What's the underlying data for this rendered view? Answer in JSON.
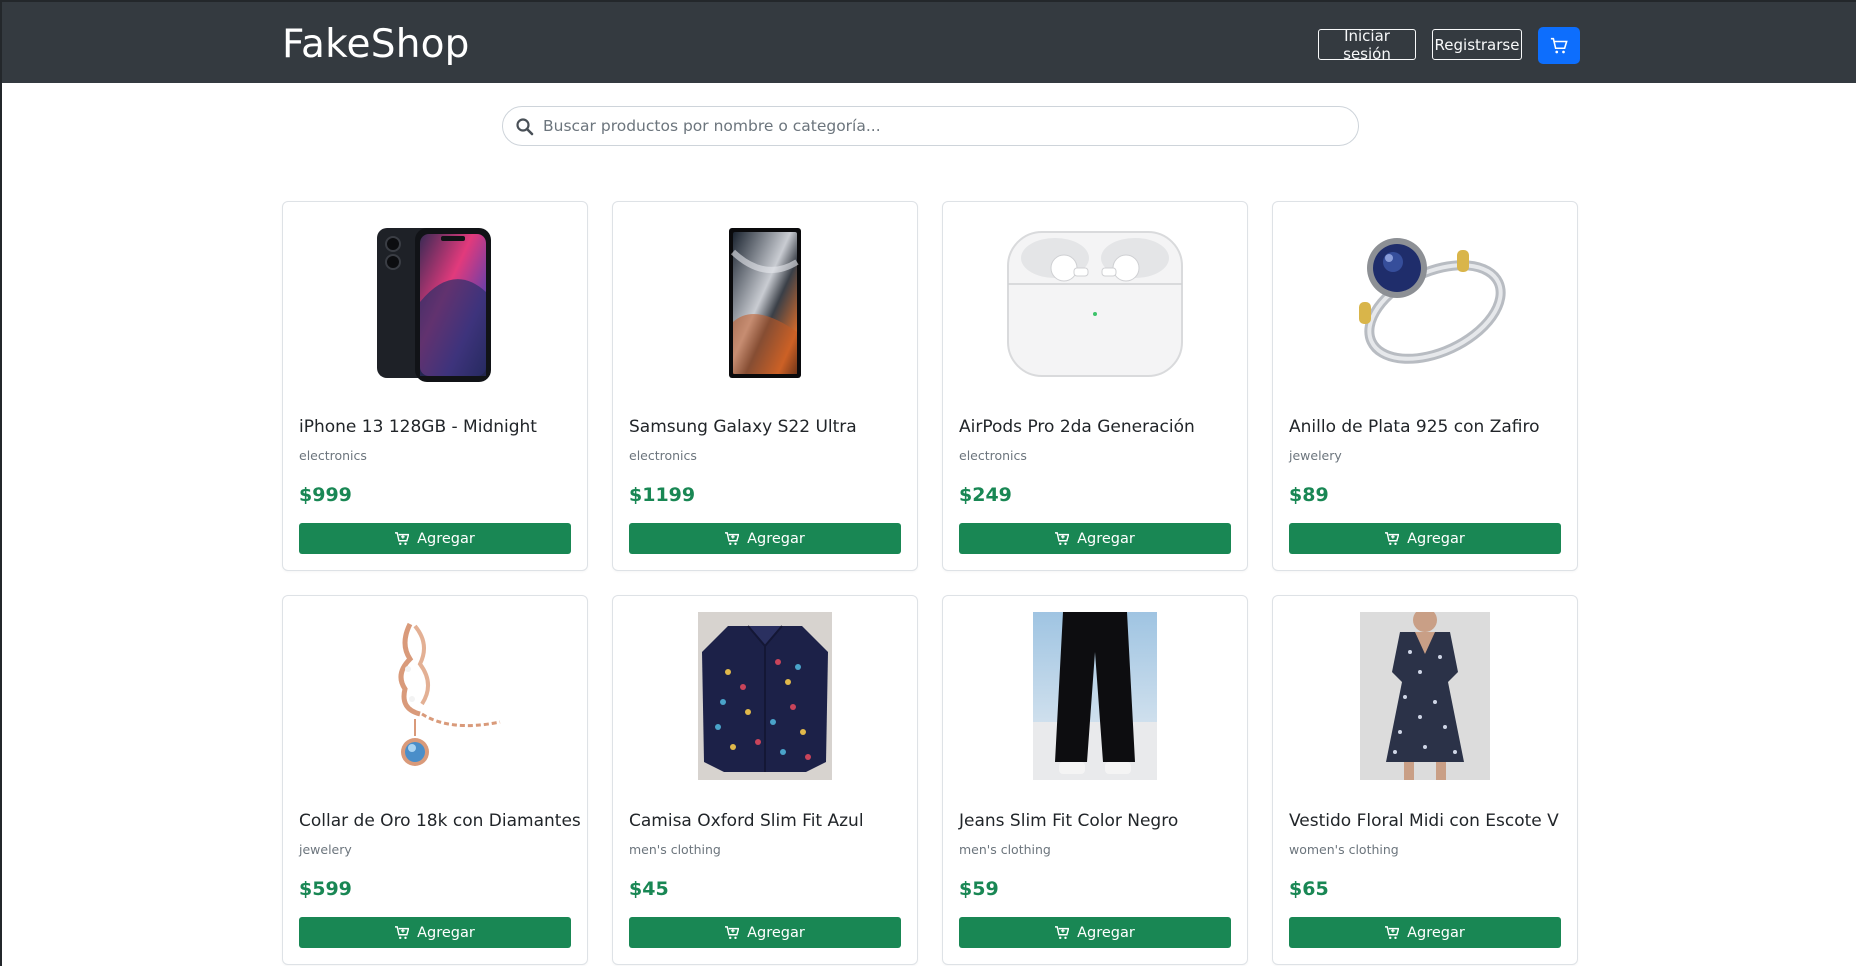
{
  "brand": "FakeShop",
  "nav": {
    "login_label": "Iniciar sesión",
    "register_label": "Registrarse",
    "cart_icon": "cart-icon"
  },
  "search": {
    "placeholder": "Buscar productos por nombre o categoría...",
    "value": ""
  },
  "colors": {
    "navbar": "#343a40",
    "primary": "#0d6efd",
    "success": "#198754"
  },
  "products": [
    {
      "title": "iPhone 13 128GB - Midnight",
      "category": "electronics",
      "price": "$999",
      "add_label": "Agregar"
    },
    {
      "title": "Samsung Galaxy S22 Ultra",
      "category": "electronics",
      "price": "$1199",
      "add_label": "Agregar"
    },
    {
      "title": "AirPods Pro 2da Generación",
      "category": "electronics",
      "price": "$249",
      "add_label": "Agregar"
    },
    {
      "title": "Anillo de Plata 925 con Zafiro",
      "category": "jewelery",
      "price": "$89",
      "add_label": "Agregar"
    },
    {
      "title": "Collar de Oro 18k con Diamantes",
      "category": "jewelery",
      "price": "$599",
      "add_label": "Agregar"
    },
    {
      "title": "Camisa Oxford Slim Fit Azul",
      "category": "men's clothing",
      "price": "$45",
      "add_label": "Agregar"
    },
    {
      "title": "Jeans Slim Fit Color Negro",
      "category": "men's clothing",
      "price": "$59",
      "add_label": "Agregar"
    },
    {
      "title": "Vestido Floral Midi con Escote V",
      "category": "women's clothing",
      "price": "$65",
      "add_label": "Agregar"
    }
  ]
}
